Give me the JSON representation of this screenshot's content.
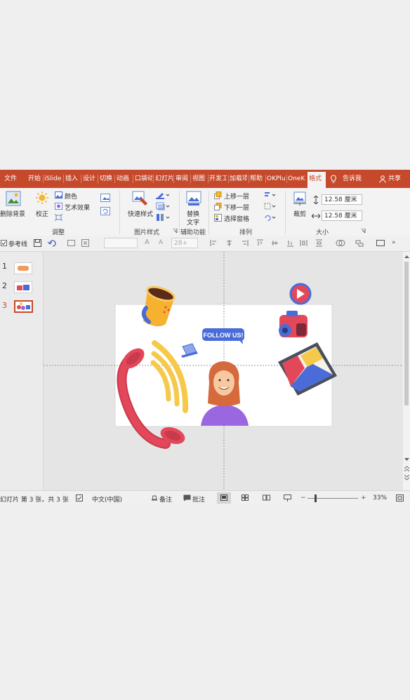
{
  "tabs": [
    "文件",
    "开始",
    "iSlide",
    "插入",
    "设计",
    "切换",
    "动画",
    "口袋动",
    "幻灯片",
    "审阅",
    "视图",
    "开发工",
    "加载项",
    "帮助",
    "OKPlu",
    "OneK",
    "格式"
  ],
  "tell_me": "告诉我",
  "share": "共享",
  "ribbon": {
    "remove_bg": "删除背景",
    "correct": "校正",
    "color": "颜色",
    "art_effect": "艺术效果",
    "adjust_label": "调整",
    "quick_style": "快速样式",
    "picture_style_label": "图片样式",
    "alt_text_1": "替换",
    "alt_text_2": "文字",
    "accessibility_label": "辅助功能",
    "bring_forward": "上移一层",
    "send_backward": "下移一层",
    "selection_pane": "选择窗格",
    "arrange_label": "排列",
    "crop": "裁剪",
    "height": "12.58 厘米",
    "width": "12.58 厘米",
    "size_label": "大小"
  },
  "qtb": {
    "guides": "参考线",
    "font_size": "28+"
  },
  "slides": [
    "1",
    "2",
    "3"
  ],
  "slide": {
    "badge": "FOLLOW US!",
    "colors": {
      "accent": "#c5492a",
      "phone": "#e3485a",
      "waves": "#f6c94a",
      "blue": "#4a6cd8",
      "purple": "#9b67e0"
    }
  },
  "status": {
    "slide_info": "幻灯片 第 3 张，共 3 张",
    "lang": "中文(中国)",
    "notes": "备注",
    "comments": "批注",
    "zoom": "33%"
  }
}
